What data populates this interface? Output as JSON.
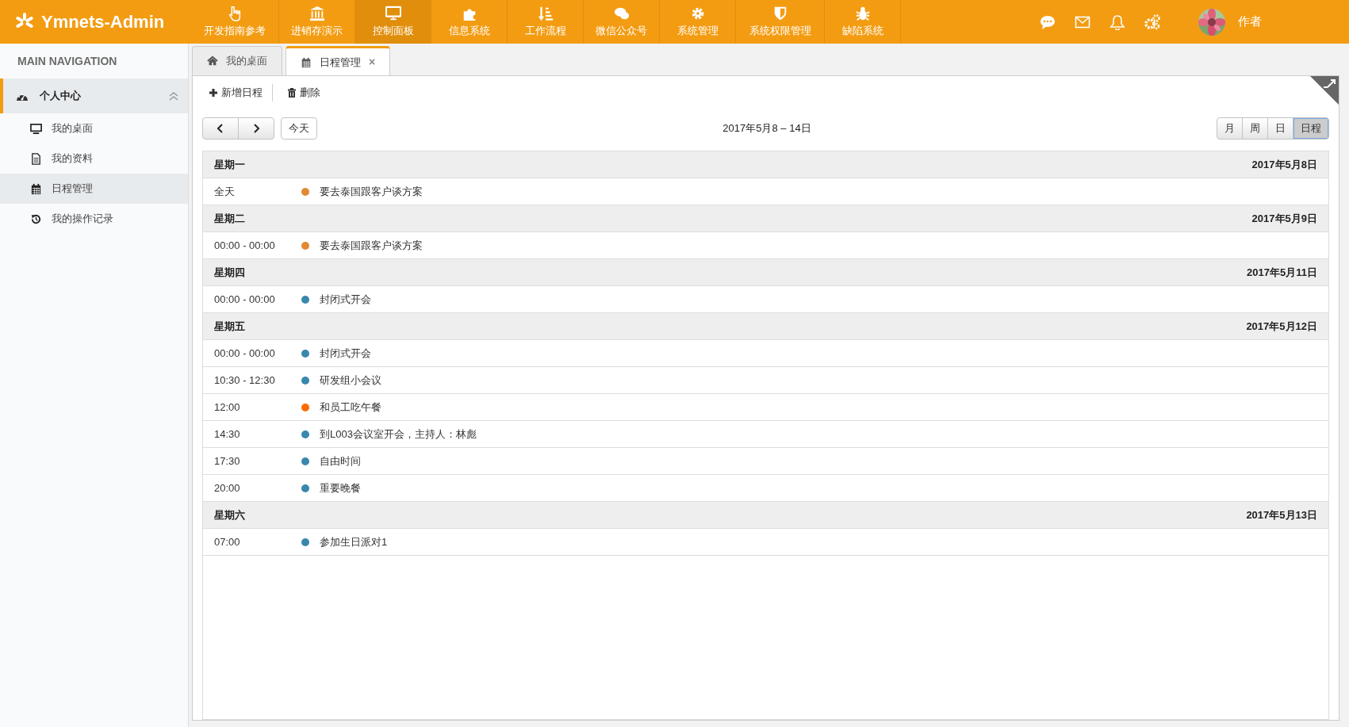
{
  "brand": {
    "name": "Ymnets-Admin"
  },
  "top_nav": [
    {
      "label": "开发指南参考",
      "selected": false
    },
    {
      "label": "进销存演示",
      "selected": false
    },
    {
      "label": "控制面板",
      "selected": true
    },
    {
      "label": "信息系统",
      "selected": false
    },
    {
      "label": "工作流程",
      "selected": false
    },
    {
      "label": "微信公众号",
      "selected": false
    },
    {
      "label": "系统管理",
      "selected": false
    },
    {
      "label": "系统权限管理",
      "selected": false
    },
    {
      "label": "缺陷系统",
      "selected": false
    }
  ],
  "user": {
    "name": "作者"
  },
  "sidebar": {
    "title": "MAIN NAVIGATION",
    "groups": [
      {
        "label": "个人中心",
        "expanded": true,
        "children": [
          {
            "label": "我的桌面",
            "selected": false
          },
          {
            "label": "我的资料",
            "selected": false
          },
          {
            "label": "日程管理",
            "selected": true
          },
          {
            "label": "我的操作记录",
            "selected": false
          }
        ]
      }
    ]
  },
  "tabs": [
    {
      "label": "我的桌面",
      "selected": false
    },
    {
      "label": "日程管理",
      "selected": true,
      "close": "×"
    }
  ],
  "toolbar": [
    {
      "label": "新增日程"
    },
    {
      "label": "删除"
    }
  ],
  "calendar": {
    "today": "今天",
    "range": "2017年5月8 – 14日",
    "views": [
      {
        "label": "月",
        "selected": false
      },
      {
        "label": "周",
        "selected": false
      },
      {
        "label": "日",
        "selected": false
      },
      {
        "label": "日程",
        "selected": true
      }
    ],
    "days": [
      {
        "weekday": "星期一",
        "date": "2017年5月8日",
        "events": [
          {
            "time": "全天",
            "title": "要去泰国跟客户谈方案",
            "color": "#e08a33"
          }
        ]
      },
      {
        "weekday": "星期二",
        "date": "2017年5月9日",
        "events": [
          {
            "time": "00:00 - 00:00",
            "title": "要去泰国跟客户谈方案",
            "color": "#e08a33"
          }
        ]
      },
      {
        "weekday": "星期四",
        "date": "2017年5月11日",
        "events": [
          {
            "time": "00:00 - 00:00",
            "title": "封闭式开会",
            "color": "#3a87ad"
          }
        ]
      },
      {
        "weekday": "星期五",
        "date": "2017年5月12日",
        "events": [
          {
            "time": "00:00 - 00:00",
            "title": "封闭式开会",
            "color": "#3a87ad"
          },
          {
            "time": "10:30 - 12:30",
            "title": "研发组小会议",
            "color": "#3a87ad"
          },
          {
            "time": "12:00",
            "title": "和员工吃午餐",
            "color": "#ff6a00"
          },
          {
            "time": "14:30",
            "title": "到L003会议室开会，主持人：林彪",
            "color": "#3a87ad"
          },
          {
            "time": "17:30",
            "title": "自由时间",
            "color": "#3a87ad"
          },
          {
            "time": "20:00",
            "title": "重要晚餐",
            "color": "#3a87ad"
          }
        ]
      },
      {
        "weekday": "星期六",
        "date": "2017年5月13日",
        "events": [
          {
            "time": "07:00",
            "title": "参加生日派对1",
            "color": "#3a87ad"
          }
        ]
      }
    ]
  }
}
